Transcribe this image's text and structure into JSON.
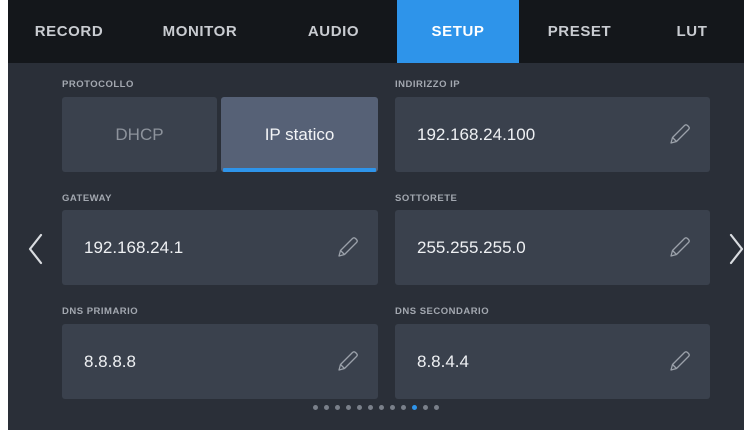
{
  "tabs": [
    {
      "label": "RECORD",
      "active": false
    },
    {
      "label": "MONITOR",
      "active": false
    },
    {
      "label": "AUDIO",
      "active": false
    },
    {
      "label": "SETUP",
      "active": true
    },
    {
      "label": "PRESET",
      "active": false
    },
    {
      "label": "LUT",
      "active": false
    }
  ],
  "protocol": {
    "label": "PROTOCOLLO",
    "options": [
      "DHCP",
      "IP statico"
    ],
    "selected": "IP statico"
  },
  "ip_address": {
    "label": "INDIRIZZO IP",
    "value": "192.168.24.100"
  },
  "gateway": {
    "label": "GATEWAY",
    "value": "192.168.24.1"
  },
  "subnet": {
    "label": "SOTTORETE",
    "value": "255.255.255.0"
  },
  "dns_primary": {
    "label": "DNS PRIMARIO",
    "value": "8.8.8.8"
  },
  "dns_secondary": {
    "label": "DNS SECONDARIO",
    "value": "8.8.4.4"
  },
  "pagination": {
    "total": 12,
    "current": 10
  },
  "icons": {
    "edit": "pencil-icon",
    "prev": "chevron-left-icon",
    "next": "chevron-right-icon"
  },
  "colors": {
    "accent": "#2e94ea",
    "tabbar": "#14171b",
    "background": "#2a2f38",
    "field": "#3a414d"
  }
}
